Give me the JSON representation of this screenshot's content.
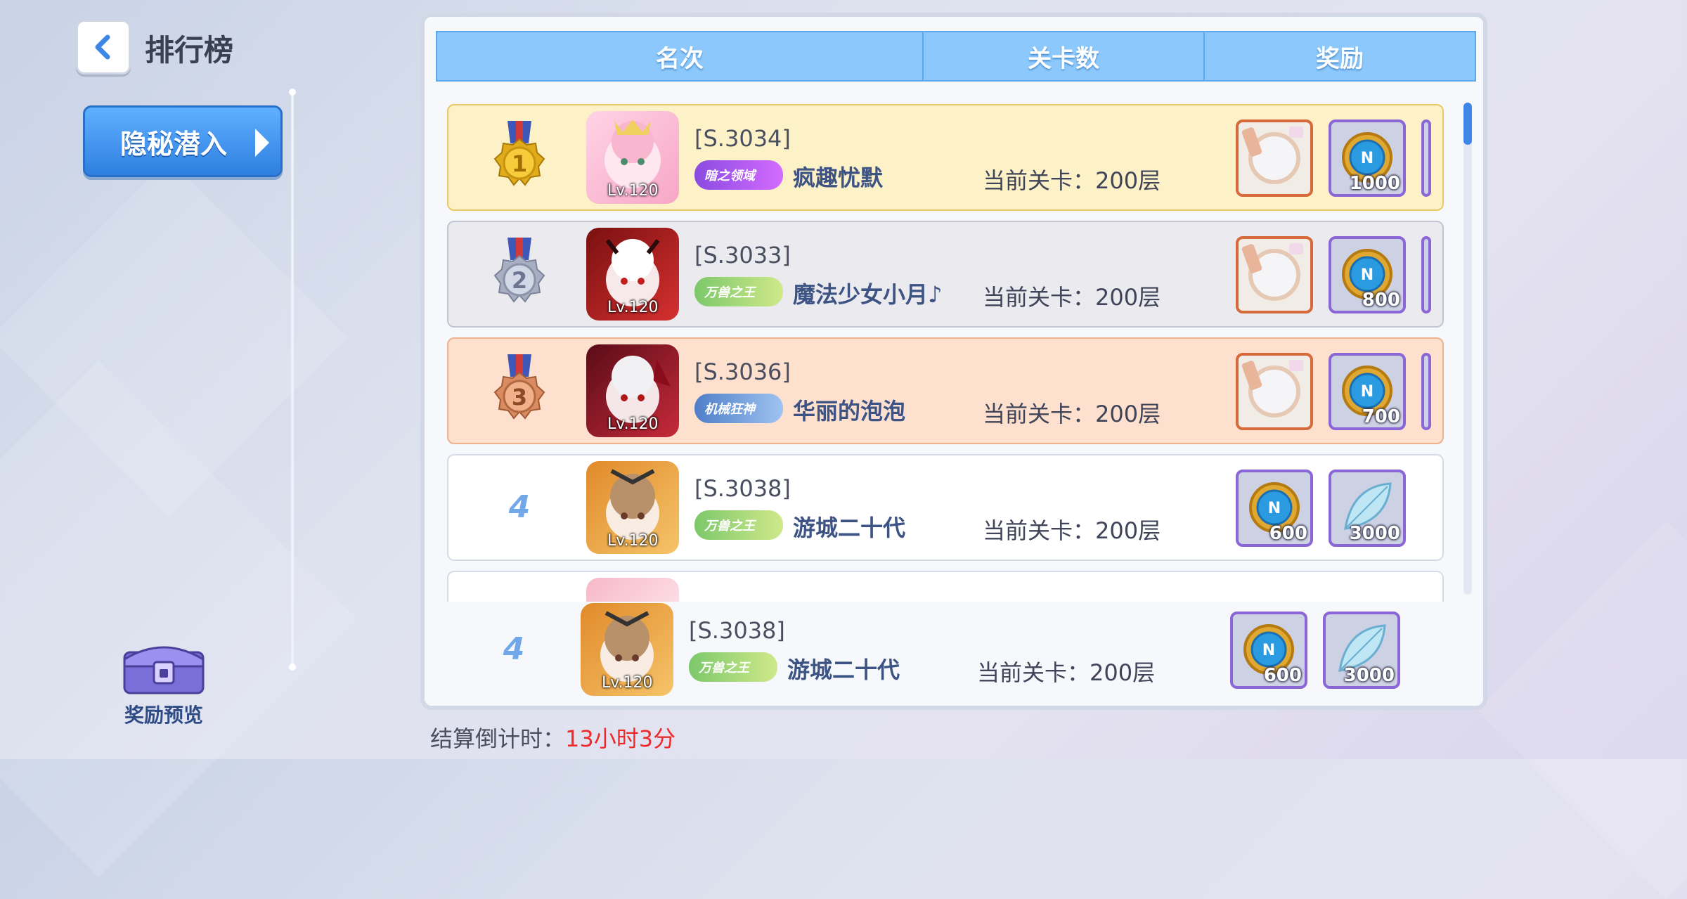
{
  "header": {
    "title": "排行榜"
  },
  "sidebar": {
    "mode_tab": "隐秘潜入",
    "reward_preview": "奖励预览"
  },
  "table": {
    "columns": [
      "名次",
      "关卡数",
      "奖励"
    ],
    "rows": [
      {
        "rank": "1",
        "server": "[S.3034]",
        "name": "疯趣忧默",
        "level": "Lv.120",
        "emblem": "暗之领域",
        "stage": "当前关卡：200层",
        "rewards": [
          {
            "icon": "frame-icon",
            "count": ""
          },
          {
            "icon": "compass-coin-icon",
            "count": "1000"
          }
        ]
      },
      {
        "rank": "2",
        "server": "[S.3033]",
        "name": "魔法少女小月♪",
        "level": "Lv.120",
        "emblem": "万兽之王",
        "stage": "当前关卡：200层",
        "rewards": [
          {
            "icon": "frame-icon",
            "count": ""
          },
          {
            "icon": "compass-coin-icon",
            "count": "800"
          }
        ]
      },
      {
        "rank": "3",
        "server": "[S.3036]",
        "name": "华丽的泡泡",
        "level": "Lv.120",
        "emblem": "机械狂神",
        "stage": "当前关卡：200层",
        "rewards": [
          {
            "icon": "frame-icon",
            "count": ""
          },
          {
            "icon": "compass-coin-icon",
            "count": "700"
          }
        ]
      },
      {
        "rank": "4",
        "server": "[S.3038]",
        "name": "游城二十代",
        "level": "Lv.120",
        "emblem": "万兽之王",
        "stage": "当前关卡：200层",
        "rewards": [
          {
            "icon": "compass-coin-icon",
            "count": "600"
          },
          {
            "icon": "crystal-leaf-icon",
            "count": "3000"
          }
        ]
      }
    ]
  },
  "my_rank": {
    "rank": "4",
    "server": "[S.3038]",
    "name": "游城二十代",
    "level": "Lv.120",
    "emblem": "万兽之王",
    "stage": "当前关卡：200层",
    "rewards": [
      {
        "icon": "compass-coin-icon",
        "count": "600"
      },
      {
        "icon": "crystal-leaf-icon",
        "count": "3000"
      }
    ]
  },
  "footer": {
    "countdown_label": "结算倒计时：",
    "countdown_value": "13小时3分"
  },
  "colors": {
    "header_blue": "#8cc8fb",
    "gold": "#fdf1c7",
    "silver": "#eaeaef",
    "bronze": "#fde0ce",
    "countdown_red": "#ef2a2a"
  }
}
